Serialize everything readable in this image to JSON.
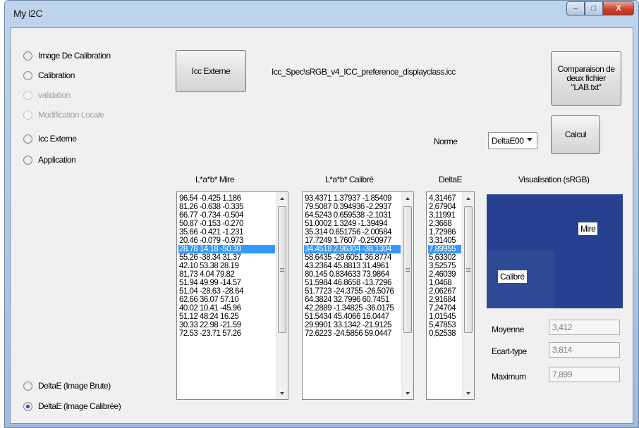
{
  "window": {
    "title": "My i2C",
    "controls": {
      "minimize": "–",
      "maximize": "□",
      "close": "X"
    }
  },
  "mode_options": [
    {
      "label": "Image De Calibration",
      "checked": false,
      "enabled": true
    },
    {
      "label": "Calibration",
      "checked": false,
      "enabled": true
    },
    {
      "label": "validation",
      "checked": false,
      "enabled": false
    },
    {
      "label": "Modification Locale",
      "checked": false,
      "enabled": false
    },
    {
      "label": "Icc Externe",
      "checked": false,
      "enabled": true
    },
    {
      "label": "Application",
      "checked": false,
      "enabled": true
    }
  ],
  "icc_button": "Icc Externe",
  "icc_profile_path": "Icc_Spec\\sRGB_v4_ICC_preference_displayclass.icc",
  "compare_button": "Comparaison de\ndeux fichier\n\"LAB.txt\"",
  "norme": {
    "label": "Norme",
    "selected": "DeltaE00"
  },
  "calcul_button": "Calcul",
  "columns": {
    "mire": "L*a*b* Mire",
    "calibre": "L*a*b* Calibré",
    "deltae": "DeltaE",
    "visualisation": "Visualisation (sRGB)"
  },
  "lists": {
    "mire": [
      "96.54 -0.425 1.186",
      "81.26 -0.638 -0.335",
      "66.77 -0.734 -0.504",
      "50.87 -0.153 -0.270",
      "35.66 -0.421 -1.231",
      "20.46 -0.079 -0.973",
      "28.78 14.18 -50.30",
      "55.26 -38.34 31.37",
      "42.10 53.38 28.19",
      "81.73 4.04 79.82",
      "51.94 49.99 -14.57",
      "51.04 -28.63 -28.64",
      "62.66 36.07 57.10",
      "40.02 10.41 -45.96",
      "51.12 48.24 16.25",
      "30.33 22.98 -21.59",
      "72.53 -23.71 57.26"
    ],
    "calibre": [
      "93.4371 1.37937 -1.85409",
      "79.5087 0.394936 -2.2937",
      "64.5243 0.659538 -2.1031",
      "51.0002 1.3249 -1.39494",
      "35.314 0.651756 -2.00584",
      "17.7249 1.7607 -0.250977",
      "34.4518 2.96304 -38.1304",
      "58.6435 -29.6051 36.8774",
      "43.2364 45.8813 31.4961",
      "80.145 0.834633 73.9864",
      "51.5984 46.8658 -13.7296",
      "51.7723 -24.3755 -26.5076",
      "64.3824 32.7996 60.7451",
      "42.2889 -1.34825 -36.0175",
      "51.5434 45.4066 16.0447",
      "29.9901 33.1342 -21.9125",
      "72.6223 -24.5856 59.0447"
    ],
    "deltae": [
      "4,31467",
      "2,67904",
      "3,11991",
      "2,3668",
      "1,72986",
      "3,31405",
      "7,89955",
      "5,63302",
      "3,52575",
      "2,46039",
      "1,0468",
      "2,06267",
      "2,91684",
      "7,24704",
      "1,01545",
      "5,47853",
      "0,52538"
    ],
    "selected_index": 6
  },
  "visualisation": {
    "mire_label": "Mire",
    "calibre_label": "Calibré",
    "mire_color": "#27408f",
    "calibre_color": "#2f4a94"
  },
  "stats": {
    "moyenne_label": "Moyenne",
    "moyenne_value": "3,412",
    "ecart_label": "Ecart-type",
    "ecart_value": "3,814",
    "maximum_label": "Maximum",
    "maximum_value": "7,899"
  },
  "delta_options": [
    {
      "label": "DeltaE (Image Brute)",
      "checked": false
    },
    {
      "label": "DeltaE (Image Calibrée)",
      "checked": true
    }
  ]
}
